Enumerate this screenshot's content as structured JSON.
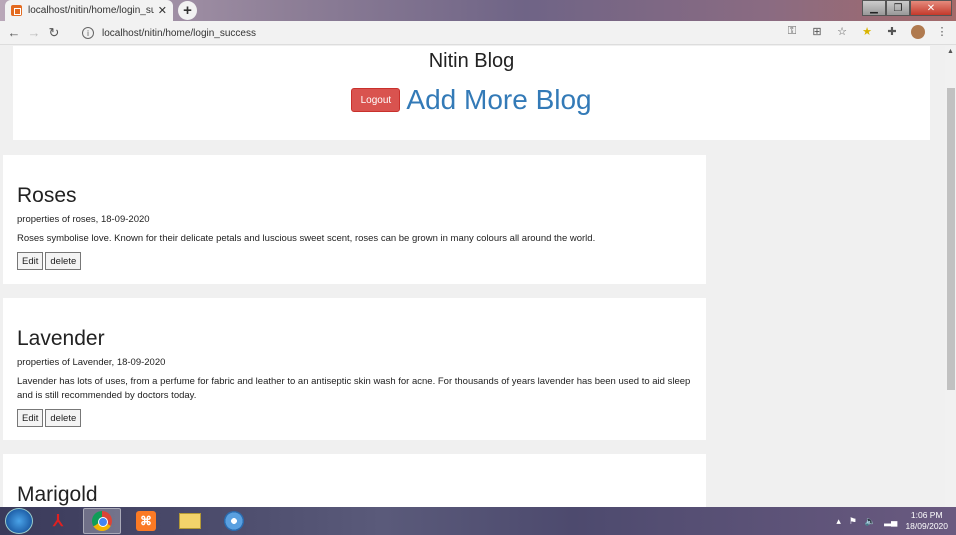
{
  "browser": {
    "tab_title": "localhost/nitin/home/login_succ",
    "tab_close": "✕",
    "new_tab": "+",
    "url": "localhost/nitin/home/login_success",
    "win_min": "▁",
    "win_max": "❐",
    "win_close": "✕"
  },
  "site": {
    "title": "Nitin Blog",
    "logout_label": "Logout",
    "add_more_label": "Add More Blog"
  },
  "posts": [
    {
      "title": "Roses",
      "meta": "properties of roses, 18-09-2020",
      "body": "Roses symbolise love. Known for their delicate petals and luscious sweet scent, roses can be grown in many colours all around the world.",
      "edit_label": "Edit",
      "delete_label": "delete"
    },
    {
      "title": "Lavender",
      "meta": "properties of Lavender, 18-09-2020",
      "body": "Lavender has lots of uses, from a perfume for fabric and leather to an antiseptic skin wash for acne. For thousands of years lavender has been used to aid sleep and is still recommended by doctors today.",
      "edit_label": "Edit",
      "delete_label": "delete"
    },
    {
      "title": "Marigold"
    }
  ],
  "taskbar": {
    "time": "1:06 PM",
    "date": "18/09/2020"
  }
}
